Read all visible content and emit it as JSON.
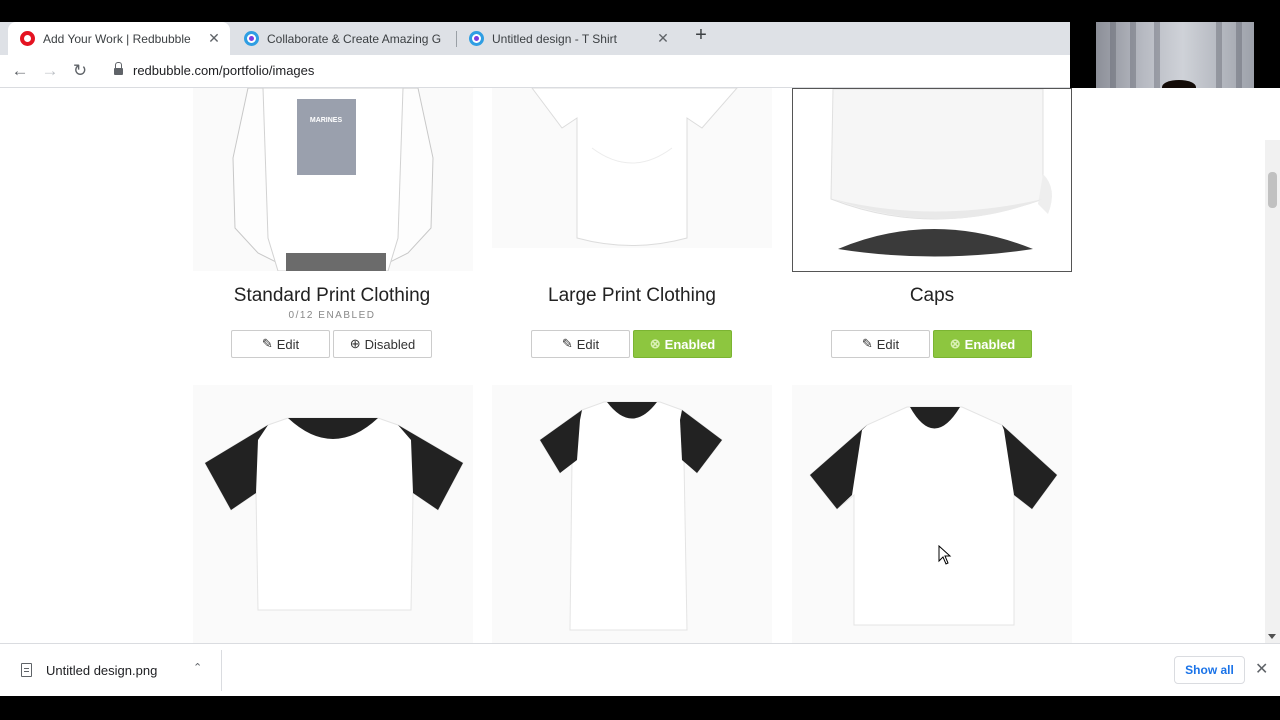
{
  "browser": {
    "tabs": [
      {
        "title": "Add Your Work | Redbubble",
        "icon": "redbubble-favicon",
        "active": true
      },
      {
        "title": "Collaborate & Create Amazing G",
        "icon": "canva-favicon",
        "active": false
      },
      {
        "title": "Untitled design - T Shirt",
        "icon": "canva-favicon",
        "active": false
      }
    ],
    "new_tab_label": "+",
    "close_glyph": "✕",
    "nav": {
      "back": "←",
      "forward": "→",
      "reload": "↻"
    },
    "url": "redbubble.com/portfolio/images"
  },
  "products_row1": [
    {
      "title": "Standard Print Clothing",
      "subtitle": "0/12 ENABLED",
      "edit_label": "Edit",
      "status_label": "Disabled",
      "status": "disabled"
    },
    {
      "title": "Large Print Clothing",
      "subtitle": "",
      "edit_label": "Edit",
      "status_label": "Enabled",
      "status": "enabled"
    },
    {
      "title": "Caps",
      "subtitle": "",
      "edit_label": "Edit",
      "status_label": "Enabled",
      "status": "enabled"
    }
  ],
  "mock_print_text": "MARINES",
  "downloads": {
    "file_name": "Untitled design.png",
    "show_all": "Show all",
    "close_glyph": "✕",
    "chevron": "⌃"
  },
  "colors": {
    "enabled_green": "#8dc63f",
    "redbubble_red": "#e41321",
    "chrome_link_blue": "#1a73e8"
  }
}
